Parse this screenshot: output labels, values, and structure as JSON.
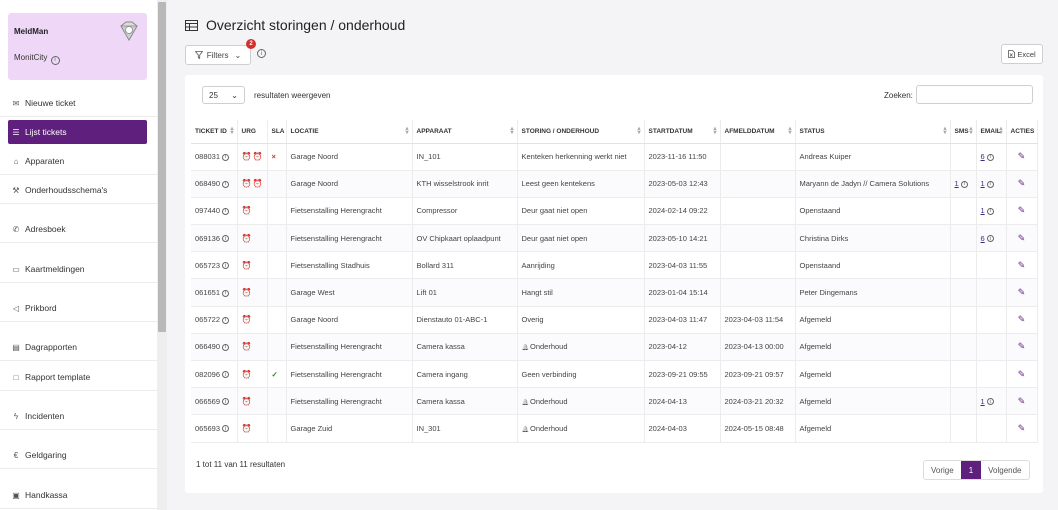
{
  "brand": {
    "name": "MeldMan",
    "city": "MonitCity"
  },
  "sidebar": {
    "items": [
      {
        "label": "Nieuwe ticket",
        "icon": "ticket-icon"
      },
      {
        "label": "Lijst tickets",
        "icon": "list-icon",
        "active": true
      },
      {
        "label": "Apparaten",
        "icon": "building-icon"
      },
      {
        "label": "Onderhoudsschema's",
        "icon": "wrench-icon"
      },
      {
        "label": "Adresboek",
        "icon": "phone-icon"
      },
      {
        "label": "Kaartmeldingen",
        "icon": "card-icon"
      },
      {
        "label": "Prikbord",
        "icon": "megaphone-icon"
      },
      {
        "label": "Dagrapporten",
        "icon": "report-icon"
      },
      {
        "label": "Rapport template",
        "icon": "document-icon"
      },
      {
        "label": "Incidenten",
        "icon": "bolt-icon"
      },
      {
        "label": "Geldgaring",
        "icon": "euro-icon"
      },
      {
        "label": "Handkassa",
        "icon": "cash-icon"
      }
    ]
  },
  "header": {
    "title": "Overzicht storingen / onderhoud",
    "filters_label": "Filters",
    "filters_count": "2",
    "excel_label": "Excel"
  },
  "table_controls": {
    "page_length": "25",
    "length_label": "resultaten weergeven",
    "search_label": "Zoeken:"
  },
  "table": {
    "headers": [
      "Ticket ID",
      "URG",
      "SLA",
      "Locatie",
      "Apparaat",
      "Storing / Onderhoud",
      "Startdatum",
      "Afmelddatum",
      "Status",
      "SMS",
      "Email",
      "Acties"
    ],
    "rows": [
      {
        "id": "088031",
        "urg": "high",
        "sla": "x",
        "locatie": "Garage Noord",
        "apparaat": "IN_101",
        "storing": "Kenteken herkenning werkt niet",
        "start": "2023-11-16 11:50",
        "afmeld": "",
        "status": "Andreas Kuiper",
        "sms": "",
        "email": "6"
      },
      {
        "id": "068490",
        "urg": "high",
        "sla": "",
        "locatie": "Garage Noord",
        "apparaat": "KTH wisselstrook inrit",
        "storing": "Leest geen kentekens",
        "start": "2023-05-03 12:43",
        "afmeld": "",
        "status": "Maryann de Jadyn // Camera Solutions",
        "sms": "1",
        "email": "1"
      },
      {
        "id": "097440",
        "urg": "low",
        "sla": "",
        "locatie": "Fietsenstalling Herengracht",
        "apparaat": "Compressor",
        "storing": "Deur gaat niet open",
        "start": "2024-02-14 09:22",
        "afmeld": "",
        "status": "Openstaand",
        "sms": "",
        "email": "1"
      },
      {
        "id": "069136",
        "urg": "low",
        "sla": "",
        "locatie": "Fietsenstalling Herengracht",
        "apparaat": "OV Chipkaart oplaadpunt",
        "storing": "Deur gaat niet open",
        "start": "2023-05-10 14:21",
        "afmeld": "",
        "status": "Christina Dirks",
        "sms": "",
        "email": "6"
      },
      {
        "id": "065723",
        "urg": "low",
        "sla": "",
        "locatie": "Fietsenstalling Stadhuis",
        "apparaat": "Bollard 311",
        "storing": "Aanrijding",
        "start": "2023-04-03 11:55",
        "afmeld": "",
        "status": "Openstaand",
        "sms": "",
        "email": ""
      },
      {
        "id": "061651",
        "urg": "low",
        "sla": "",
        "locatie": "Garage West",
        "apparaat": "Lift 01",
        "storing": "Hangt stil",
        "start": "2023-01-04 15:14",
        "afmeld": "",
        "status": "Peter Dingemans",
        "sms": "",
        "email": ""
      },
      {
        "id": "065722",
        "urg": "low",
        "sla": "",
        "locatie": "Garage Noord",
        "apparaat": "Dienstauto 01-ABC-1",
        "storing": "Overig",
        "start": "2023-04-03 11:47",
        "afmeld": "2023-04-03 11:54",
        "status": "Afgemeld",
        "sms": "",
        "email": ""
      },
      {
        "id": "066490",
        "urg": "low",
        "sla": "",
        "locatie": "Fietsenstalling Herengracht",
        "apparaat": "Camera kassa",
        "storing": "Onderhoud",
        "bell": true,
        "start": "2023-04-12",
        "afmeld": "2023-04-13 00:00",
        "status": "Afgemeld",
        "sms": "",
        "email": ""
      },
      {
        "id": "082096",
        "urg": "low",
        "sla": "ok",
        "locatie": "Fietsenstalling Herengracht",
        "apparaat": "Camera ingang",
        "storing": "Geen verbinding",
        "start": "2023-09-21 09:55",
        "afmeld": "2023-09-21 09:57",
        "status": "Afgemeld",
        "sms": "",
        "email": ""
      },
      {
        "id": "066569",
        "urg": "low",
        "sla": "",
        "locatie": "Fietsenstalling Herengracht",
        "apparaat": "Camera kassa",
        "storing": "Onderhoud",
        "bell": true,
        "start": "2024-04-13",
        "afmeld": "2024-03-21 20:32",
        "status": "Afgemeld",
        "sms": "",
        "email": "1"
      },
      {
        "id": "065693",
        "urg": "low",
        "sla": "",
        "locatie": "Garage Zuid",
        "apparaat": "IN_301",
        "storing": "Onderhoud",
        "bell": true,
        "start": "2024-04-03",
        "afmeld": "2024-05-15 08:48",
        "status": "Afgemeld",
        "sms": "",
        "email": ""
      }
    ]
  },
  "footer": {
    "info": "1 tot 11 van 11 resultaten",
    "prev": "Vorige",
    "page": "1",
    "next": "Volgende"
  },
  "colors": {
    "accent": "#5e1f7d",
    "brand_bg": "#efd8f7",
    "urgent": "#e53935"
  }
}
